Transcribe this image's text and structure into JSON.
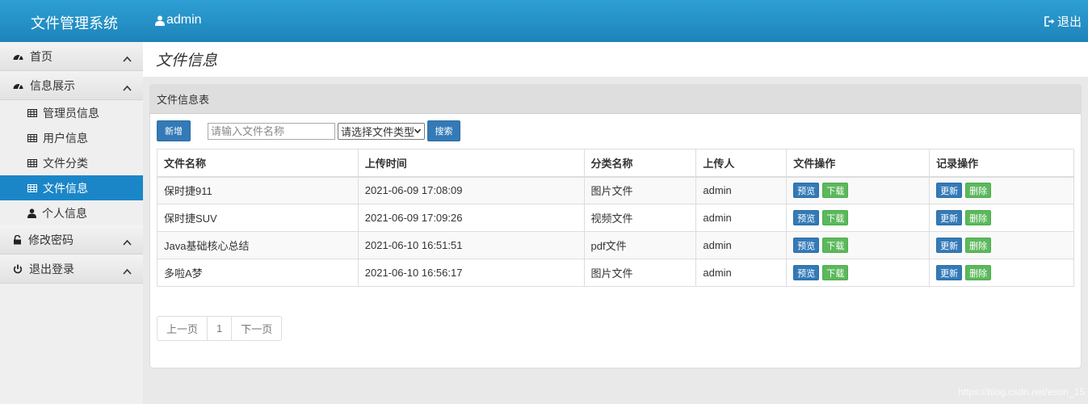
{
  "header": {
    "brand": "文件管理系统",
    "user": "admin",
    "logout": "退出"
  },
  "sidebar": {
    "home": "首页",
    "info_group": "信息展示",
    "items": [
      {
        "label": "管理员信息"
      },
      {
        "label": "用户信息"
      },
      {
        "label": "文件分类"
      },
      {
        "label": "文件信息"
      },
      {
        "label": "个人信息"
      }
    ],
    "change_password": "修改密码",
    "logout": "退出登录"
  },
  "page": {
    "title": "文件信息",
    "panel_title": "文件信息表"
  },
  "toolbar": {
    "add_label": "新增",
    "search_placeholder": "请输入文件名称",
    "type_select": "请选择文件类型",
    "search_label": "搜索"
  },
  "table": {
    "headers": [
      "文件名称",
      "上传时间",
      "分类名称",
      "上传人",
      "文件操作",
      "记录操作"
    ],
    "rows": [
      {
        "name": "保时捷911",
        "time": "2021-06-09 17:08:09",
        "category": "图片文件",
        "uploader": "admin"
      },
      {
        "name": "保时捷SUV",
        "time": "2021-06-09 17:09:26",
        "category": "视频文件",
        "uploader": "admin"
      },
      {
        "name": "Java基础核心总结",
        "time": "2021-06-10 16:51:51",
        "category": "pdf文件",
        "uploader": "admin"
      },
      {
        "name": "多啦A梦",
        "time": "2021-06-10 16:56:17",
        "category": "图片文件",
        "uploader": "admin"
      }
    ],
    "actions": {
      "preview": "预览",
      "download": "下载",
      "update": "更新",
      "delete": "删除"
    }
  },
  "pagination": {
    "prev": "上一页",
    "page": "1",
    "next": "下一页"
  },
  "watermark": "https://blog.csdn.net/eson_15",
  "colors": {
    "header": "#1d84ba",
    "active_item": "#1b86c7",
    "primary": "#337ab7",
    "success": "#5cb85c"
  }
}
